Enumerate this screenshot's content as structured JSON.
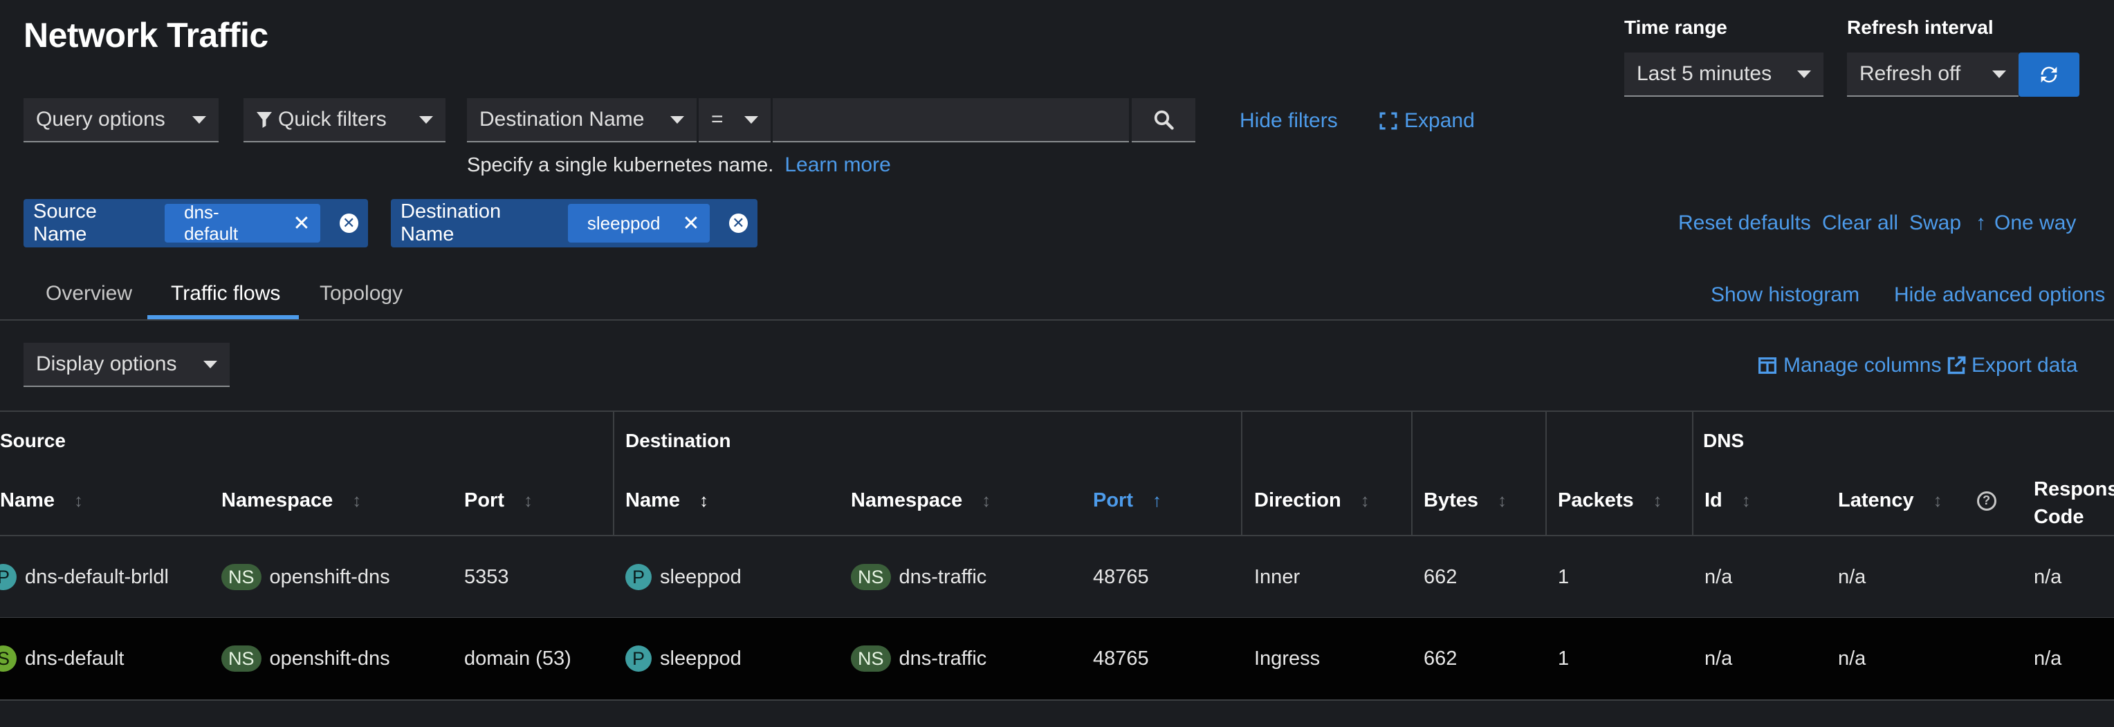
{
  "page": {
    "title": "Network Traffic"
  },
  "controls": {
    "time_range_label": "Time range",
    "time_range_value": "Last 5 minutes",
    "refresh_label": "Refresh interval",
    "refresh_value": "Refresh off"
  },
  "filters": {
    "query_options": "Query options",
    "quick_filters": "Quick filters",
    "field": "Destination Name",
    "operator": "=",
    "search_value": "",
    "hide_filters": "Hide filters",
    "expand": "Expand",
    "hint_text": "Specify a single kubernetes name.",
    "learn_more": "Learn more"
  },
  "chips": [
    {
      "label": "Source Name",
      "value": "dns-default"
    },
    {
      "label": "Destination Name",
      "value": "sleeppod"
    }
  ],
  "chip_actions": {
    "reset_defaults": "Reset defaults",
    "clear_all": "Clear all",
    "swap": "Swap",
    "one_way": "One way"
  },
  "tabs": [
    {
      "label": "Overview",
      "active": false
    },
    {
      "label": "Traffic flows",
      "active": true
    },
    {
      "label": "Topology",
      "active": false
    }
  ],
  "tab_actions": {
    "show_histogram": "Show histogram",
    "hide_advanced": "Hide advanced options"
  },
  "toolbar": {
    "display_options": "Display options",
    "manage_columns": "Manage columns",
    "export_data": "Export data"
  },
  "table": {
    "groups": {
      "source": "Source",
      "destination": "Destination",
      "dns": "DNS"
    },
    "columns": {
      "src_name": "Name",
      "src_namespace": "Namespace",
      "src_port": "Port",
      "dst_name": "Name",
      "dst_namespace": "Namespace",
      "dst_port": "Port",
      "direction": "Direction",
      "bytes": "Bytes",
      "packets": "Packets",
      "dns_id": "Id",
      "dns_latency": "Latency",
      "dns_response": "Response Code"
    },
    "rows": [
      {
        "src_kind": "P",
        "src_name": "dns-default-brldl",
        "src_ns_kind": "NS",
        "src_namespace": "openshift-dns",
        "src_port": "5353",
        "dst_kind": "P",
        "dst_name": "sleeppod",
        "dst_ns_kind": "NS",
        "dst_namespace": "dns-traffic",
        "dst_port": "48765",
        "direction": "Inner",
        "bytes": "662",
        "packets": "1",
        "dns_id": "n/a",
        "dns_latency": "n/a",
        "dns_response": "n/a"
      },
      {
        "src_kind": "S",
        "src_name": "dns-default",
        "src_ns_kind": "NS",
        "src_namespace": "openshift-dns",
        "src_port": "domain (53)",
        "dst_kind": "P",
        "dst_name": "sleeppod",
        "dst_ns_kind": "NS",
        "dst_namespace": "dns-traffic",
        "dst_port": "48765",
        "direction": "Ingress",
        "bytes": "662",
        "packets": "1",
        "dns_id": "n/a",
        "dns_latency": "n/a",
        "dns_response": "n/a"
      }
    ]
  },
  "colors": {
    "accent": "#4d9bea",
    "chip_bg": "#1f4e8c",
    "refresh_btn": "#1f6fc9"
  }
}
